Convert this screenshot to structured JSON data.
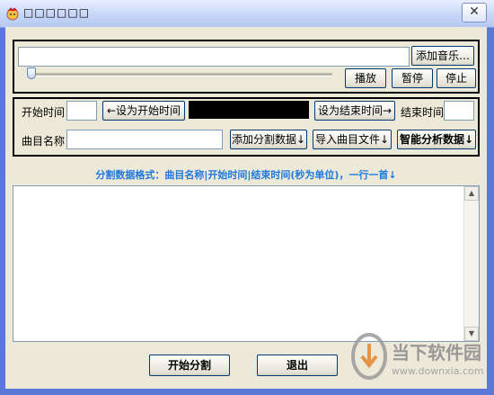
{
  "window": {
    "title": "□□□□□□",
    "close_glyph": "✕"
  },
  "player": {
    "path_value": "",
    "add_music_label": "添加音乐…",
    "play_label": "播放",
    "pause_label": "暂停",
    "stop_label": "停止",
    "position": 0
  },
  "split": {
    "start_time_label": "开始时间",
    "start_time_value": "",
    "set_start_label": "←设为开始时间",
    "set_end_label": "设为结束时间→",
    "end_time_label": "结束时间",
    "end_time_value": "",
    "track_name_label": "曲目名称",
    "track_name_value": "",
    "add_split_label": "添加分割数据↓",
    "import_file_label": "导入曲目文件↓",
    "smart_analyze_label": "智能分析数据↓"
  },
  "hint": "分割数据格式：曲目名称|开始时间|结束时间(秒为单位)，一行一首↓",
  "data_text": "",
  "footer": {
    "start_split_label": "开始分割",
    "exit_label": "退出"
  },
  "watermark": {
    "name": "当下软件园",
    "url": "www.downxia.com"
  },
  "colors": {
    "frame": "#5a78d8",
    "face": "#ece9d8",
    "hint": "#1f78e0"
  }
}
